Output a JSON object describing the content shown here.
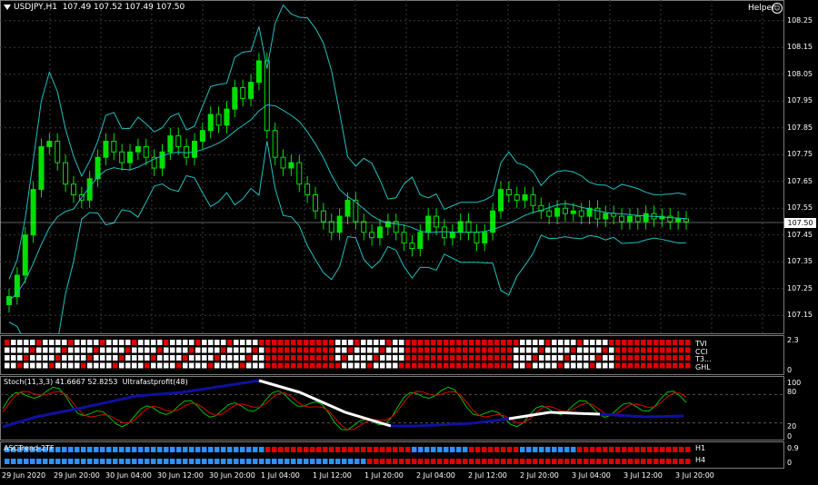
{
  "title": {
    "symbol": "USDJPY,H1",
    "ohlc": "107.49 107.52 107.49 107.50"
  },
  "helper": {
    "label": "Helper",
    "icon": "helper-icon"
  },
  "current_price": "107.50",
  "main_yaxis": [
    "108.25",
    "108.15",
    "108.05",
    "107.95",
    "107.85",
    "107.75",
    "107.65",
    "107.55",
    "107.45",
    "107.35",
    "107.25",
    "107.15"
  ],
  "signals": {
    "ylabels": [
      "2.3",
      "0"
    ],
    "rows": [
      "TVI",
      "CCI",
      "T3...",
      "GHL"
    ]
  },
  "stoch": {
    "label": "Stoch(11,3,3) 41.6667 52.8253",
    "label2": "Ultrafastprofit(48)",
    "ylabels": [
      "100",
      "80",
      "20",
      "0"
    ]
  },
  "trend": {
    "label": "ASCTrend-2TF",
    "row_labels": [
      "H1",
      "H4"
    ],
    "ylabels": [
      "0.9",
      "0"
    ]
  },
  "xaxis": [
    "29 Jun 2020",
    "29 Jun 20:00",
    "30 Jun 04:00",
    "30 Jun 12:00",
    "30 Jun 20:00",
    "1 Jul 04:00",
    "1 Jul 12:00",
    "1 Jul 20:00",
    "2 Jul 04:00",
    "2 Jul 12:00",
    "2 Jul 20:00",
    "3 Jul 04:00",
    "3 Jul 12:00",
    "3 Jul 20:00"
  ],
  "colors": {
    "bull": "#00e000",
    "bear": "#000000",
    "wick": "#00e000",
    "band": "#20c0c0",
    "red": "#e00000",
    "white": "#ffffff",
    "blue": "#3090ff",
    "navy": "#1010a0"
  },
  "chart_data": {
    "type": "candlestick",
    "closes": [
      107.22,
      107.3,
      107.45,
      107.62,
      107.78,
      107.8,
      107.72,
      107.64,
      107.6,
      107.58,
      107.66,
      107.74,
      107.8,
      107.76,
      107.72,
      107.76,
      107.78,
      107.74,
      107.7,
      107.76,
      107.82,
      107.78,
      107.74,
      107.8,
      107.84,
      107.9,
      107.86,
      107.92,
      108.0,
      107.96,
      108.02,
      108.1,
      107.84,
      107.74,
      107.7,
      107.72,
      107.64,
      107.6,
      107.54,
      107.5,
      107.46,
      107.52,
      107.58,
      107.5,
      107.46,
      107.44,
      107.48,
      107.5,
      107.46,
      107.42,
      107.4,
      107.46,
      107.52,
      107.48,
      107.44,
      107.46,
      107.5,
      107.46,
      107.42,
      107.46,
      107.54,
      107.62,
      107.6,
      107.58,
      107.6,
      107.56,
      107.54,
      107.52,
      107.55,
      107.53,
      107.54,
      107.52,
      107.55,
      107.51,
      107.53,
      107.52,
      107.5,
      107.52,
      107.5,
      107.53,
      107.51,
      107.52,
      107.5,
      107.51,
      107.5
    ],
    "ylim": [
      107.1,
      108.3
    ]
  }
}
